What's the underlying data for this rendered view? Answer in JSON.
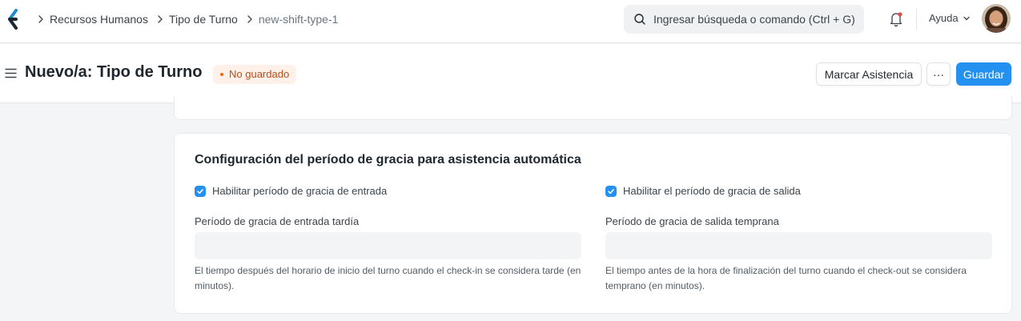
{
  "breadcrumbs": [
    "Recursos Humanos",
    "Tipo de Turno",
    "new-shift-type-1"
  ],
  "search": {
    "placeholder": "Ingresar búsqueda o comando (Ctrl + G)"
  },
  "navbar": {
    "help_label": "Ayuda"
  },
  "page": {
    "title": "Nuevo/a: Tipo de Turno",
    "status": "No guardado"
  },
  "actions": {
    "mark_attendance": "Marcar Asistencia",
    "more": "···",
    "save": "Guardar"
  },
  "section": {
    "title": "Configuración del período de gracia para asistencia automática",
    "left": {
      "checkbox_label": "Habilitar período de gracia de entrada",
      "checked": true,
      "field_label": "Período de gracia de entrada tardía",
      "value": "",
      "description": "El tiempo después del horario de inicio del turno cuando el check-in se considera tarde (en minutos)."
    },
    "right": {
      "checkbox_label": "Habilitar el período de gracia de salida",
      "checked": true,
      "field_label": "Período de gracia de salida temprana",
      "value": "",
      "description": "El tiempo antes de la hora de finalización del turno cuando el check-out se considera temprano (en minutos)."
    }
  },
  "colors": {
    "primary": "#2490ef",
    "indicator_bg": "#fff1ea",
    "indicator_text": "#b94e18",
    "notification_dot": "#e24c4c"
  }
}
